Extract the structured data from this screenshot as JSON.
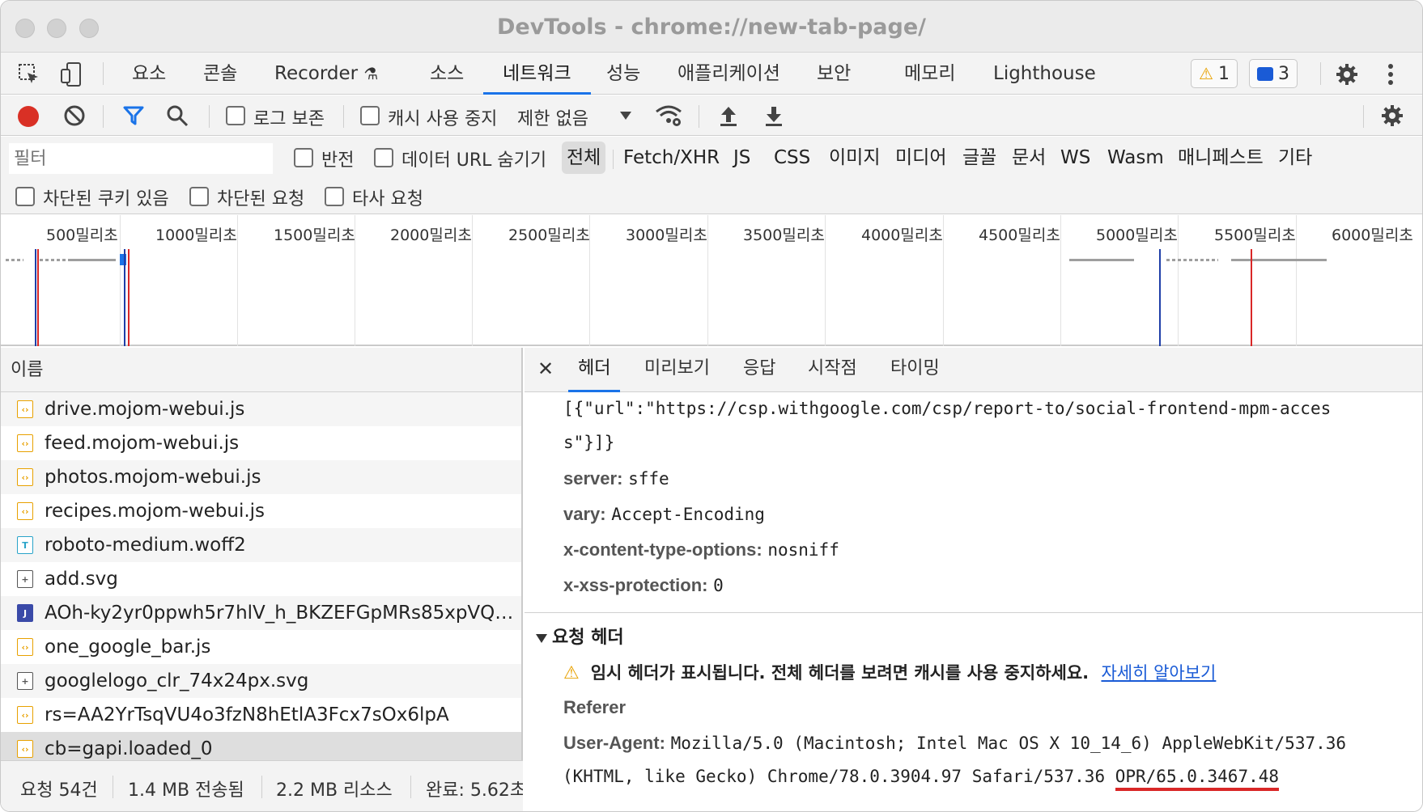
{
  "window": {
    "title": "DevTools - chrome://new-tab-page/"
  },
  "main_tabs": [
    "요소",
    "콘솔",
    "Recorder",
    "소스",
    "네트워크",
    "성능",
    "애플리케이션",
    "보안",
    "메모리",
    "Lighthouse"
  ],
  "active_tab": "네트워크",
  "badges": {
    "warnings": "1",
    "messages": "3"
  },
  "toolbar": {
    "preserve_log": "로그 보존",
    "disable_cache": "캐시 사용 중지",
    "throttle": "제한 없음"
  },
  "filter": {
    "placeholder": "필터",
    "invert": "반전",
    "hide_data_urls": "데이터 URL 숨기기",
    "types": [
      "전체",
      "Fetch/XHR",
      "JS",
      "CSS",
      "이미지",
      "미디어",
      "글꼴",
      "문서",
      "WS",
      "Wasm",
      "매니페스트",
      "기타"
    ],
    "blocked_cookies": "차단된 쿠키 있음",
    "blocked_requests": "차단된 요청",
    "third_party": "타사 요청"
  },
  "timeline": {
    "ticks": [
      "500밀리초",
      "1000밀리초",
      "1500밀리초",
      "2000밀리초",
      "2500밀리초",
      "3000밀리초",
      "3500밀리초",
      "4000밀리초",
      "4500밀리초",
      "5000밀리초",
      "5500밀리초",
      "6000밀리초"
    ]
  },
  "requests": {
    "header": "이름",
    "rows": [
      {
        "name": "drive.mojom-webui.js",
        "type": "js"
      },
      {
        "name": "feed.mojom-webui.js",
        "type": "js"
      },
      {
        "name": "photos.mojom-webui.js",
        "type": "js"
      },
      {
        "name": "recipes.mojom-webui.js",
        "type": "js"
      },
      {
        "name": "roboto-medium.woff2",
        "type": "font"
      },
      {
        "name": "add.svg",
        "type": "svg"
      },
      {
        "name": "AOh-ky2yr0ppwh5r7hlV_h_BKZEFGpMRs85xpVQ_...",
        "type": "img"
      },
      {
        "name": "one_google_bar.js",
        "type": "js"
      },
      {
        "name": "googlelogo_clr_74x24px.svg",
        "type": "svg"
      },
      {
        "name": "rs=AA2YrTsqVU4o3fzN8hEtlA3Fcx7sOx6lpA",
        "type": "js"
      },
      {
        "name": "cb=gapi.loaded_0",
        "type": "js"
      }
    ]
  },
  "status": {
    "requests": "요청 54건",
    "transferred": "1.4 MB 전송됨",
    "resources": "2.2 MB 리소스",
    "finish": "완료: 5.62초"
  },
  "details": {
    "tabs": [
      "헤더",
      "미리보기",
      "응답",
      "시작점",
      "타이밍"
    ],
    "active_tab": "헤더",
    "report_to_line1": "[{\"url\":\"https://csp.withgoogle.com/csp/report-to/social-frontend-mpm-acces",
    "report_to_line2": "s\"}]}",
    "response_headers": [
      {
        "key": "server:",
        "value": "sffe"
      },
      {
        "key": "vary:",
        "value": "Accept-Encoding"
      },
      {
        "key": "x-content-type-options:",
        "value": "nosniff"
      },
      {
        "key": "x-xss-protection:",
        "value": "0"
      }
    ],
    "request_section": "요청 헤더",
    "warning": "임시 헤더가 표시됩니다. 전체 헤더를 보려면 캐시를 사용 중지하세요.",
    "learn_more": "자세히 알아보기",
    "referer": "Referer",
    "ua_key": "User-Agent:",
    "ua_line1": "Mozilla/5.0 (Macintosh; Intel Mac OS X 10_14_6) AppleWebKit/537.36",
    "ua_line2_a": "(KHTML, like Gecko) Chrome/78.0.3904.97 Safari/537.36 ",
    "ua_line2_b": "OPR/65.0.3467.48"
  }
}
